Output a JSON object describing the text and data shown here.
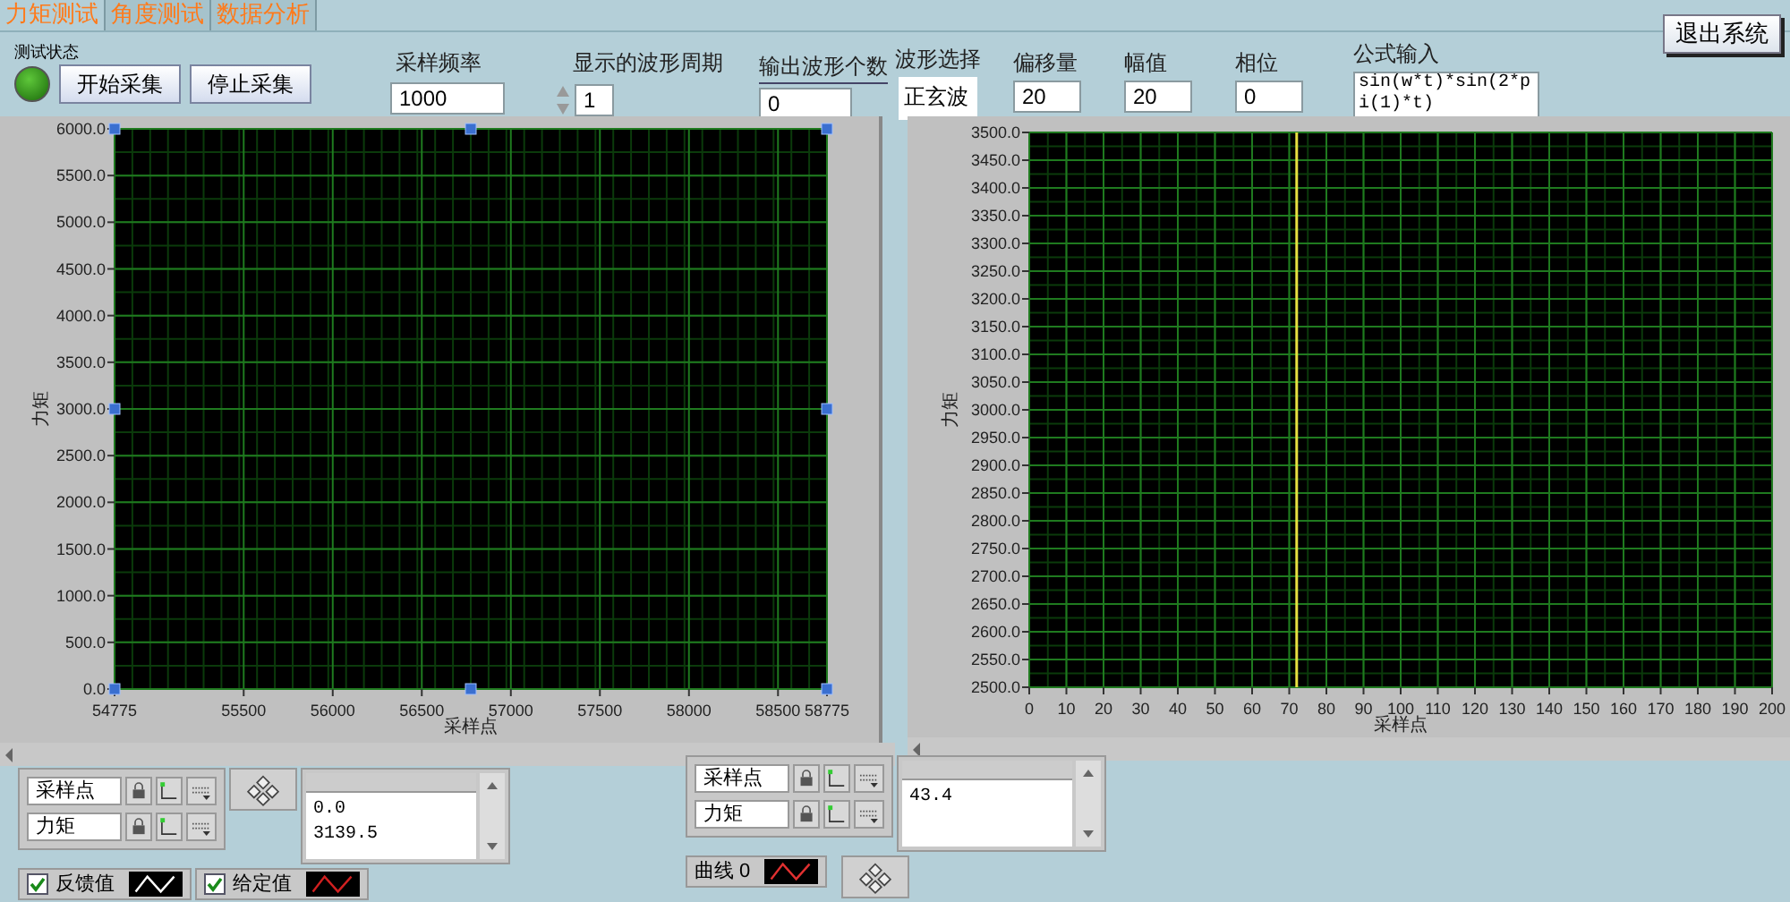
{
  "tabs": [
    {
      "label": "力矩测试",
      "selected": true
    },
    {
      "label": "角度测试",
      "selected": false
    },
    {
      "label": "数据分析",
      "selected": false
    }
  ],
  "exit_button": "退出系统",
  "status": {
    "label": "测试状态",
    "on": true
  },
  "buttons": [
    "开始采集",
    "停止采集"
  ],
  "sample_rate": {
    "label": "采样频率",
    "value": "1000"
  },
  "periods": {
    "label": "显示的波形周期",
    "value": "1"
  },
  "output_count": {
    "label": "输出波形个数",
    "value": "0"
  },
  "waveform": {
    "label": "波形选择",
    "value": "正玄波"
  },
  "offset": {
    "label": "偏移量",
    "value": "20"
  },
  "amplitude": {
    "label": "幅值",
    "value": "20"
  },
  "phase": {
    "label": "相位",
    "value": "0"
  },
  "formula": {
    "label": "公式输入",
    "value": "sin(w*t)*sin(2*pi(1)*t)"
  },
  "graphs": [
    {
      "chart_data": {
        "type": "line",
        "xlabel": "采样点",
        "ylabel": "力矩",
        "grid": true,
        "xlim": [
          54775,
          58775
        ],
        "ylim": [
          0,
          6000
        ],
        "xticks": [
          54775,
          55500,
          56000,
          56500,
          57000,
          57500,
          58000,
          58500,
          58775
        ],
        "yticks": [
          {
            "value": 0,
            "label": "0.0"
          },
          {
            "value": 500,
            "label": "500.0"
          },
          {
            "value": 1000,
            "label": "1000.0"
          },
          {
            "value": 1500,
            "label": "1500.0"
          },
          {
            "value": 2000,
            "label": "2000.0"
          },
          {
            "value": 2500,
            "label": "2500.0"
          },
          {
            "value": 3000,
            "label": "3000.0"
          },
          {
            "value": 3500,
            "label": "3500.0"
          },
          {
            "value": 4000,
            "label": "4000.0"
          },
          {
            "value": 4500,
            "label": "4500.0"
          },
          {
            "value": 5000,
            "label": "5000.0"
          },
          {
            "value": 5500,
            "label": "5500.0"
          },
          {
            "value": 6000,
            "label": "6000.0"
          }
        ]
      },
      "scale_legend": [
        "采样点",
        "力矩"
      ],
      "cursor_table": {
        "cells": [
          "0.0",
          "3139.5"
        ]
      },
      "plots": [
        {
          "name": "反馈值",
          "checked": true,
          "color": "#ffffff"
        },
        {
          "name": "给定值",
          "checked": true,
          "color": "#d02020"
        }
      ]
    },
    {
      "chart_data": {
        "type": "line",
        "xlabel": "采样点",
        "ylabel": "力矩",
        "xlim": [
          0,
          200
        ],
        "ylim": [
          2500,
          3500
        ],
        "xticks": [
          0,
          10,
          20,
          30,
          40,
          50,
          60,
          70,
          80,
          90,
          100,
          110,
          120,
          130,
          140,
          150,
          160,
          170,
          180,
          190,
          200
        ],
        "yticks": [
          {
            "value": 2500,
            "label": "2500.0"
          },
          {
            "value": 2550,
            "label": "2550.0"
          },
          {
            "value": 2600,
            "label": "2600.0"
          },
          {
            "value": 2650,
            "label": "2650.0"
          },
          {
            "value": 2700,
            "label": "2700.0"
          },
          {
            "value": 2750,
            "label": "2750.0"
          },
          {
            "value": 2800,
            "label": "2800.0"
          },
          {
            "value": 2850,
            "label": "2850.0"
          },
          {
            "value": 2900,
            "label": "2900.0"
          },
          {
            "value": 2950,
            "label": "2950.0"
          },
          {
            "value": 3000,
            "label": "3000.0"
          },
          {
            "value": 3050,
            "label": "3050.0"
          },
          {
            "value": 3100,
            "label": "3100.0"
          },
          {
            "value": 3150,
            "label": "3150.0"
          },
          {
            "value": 3200,
            "label": "3200.0"
          },
          {
            "value": 3250,
            "label": "3250.0"
          },
          {
            "value": 3300,
            "label": "3300.0"
          },
          {
            "value": 3350,
            "label": "3350.0"
          },
          {
            "value": 3400,
            "label": "3400.0"
          },
          {
            "value": 3450,
            "label": "3450.0"
          },
          {
            "value": 3500,
            "label": "3500.0"
          }
        ],
        "grid": true,
        "ref_lines": [
          {
            "axis": "x",
            "value": 72,
            "color": "#e8e040"
          }
        ]
      },
      "scale_legend": [
        "采样点",
        "力矩"
      ],
      "cursor_table": {
        "cells": [
          "43.4"
        ]
      },
      "plots": [
        {
          "name": "曲线 0",
          "color": "#e03030"
        }
      ]
    }
  ]
}
